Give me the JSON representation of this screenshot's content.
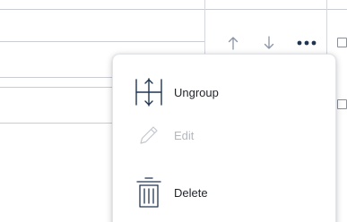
{
  "toolbar": {
    "move_up_icon": "arrow-up-icon",
    "move_down_icon": "arrow-down-icon",
    "more_icon": "more-options-icon"
  },
  "menu": {
    "items": [
      {
        "label": "Ungroup",
        "icon": "ungroup-icon",
        "enabled": true
      },
      {
        "label": "Edit",
        "icon": "pencil-icon",
        "enabled": false
      },
      {
        "label": "Delete",
        "icon": "trash-icon",
        "enabled": true
      }
    ]
  },
  "colors": {
    "icon_dark": "#1f3552",
    "icon_arrow": "#8a94a6",
    "disabled": "#b4b8be",
    "text": "#1f2329"
  }
}
